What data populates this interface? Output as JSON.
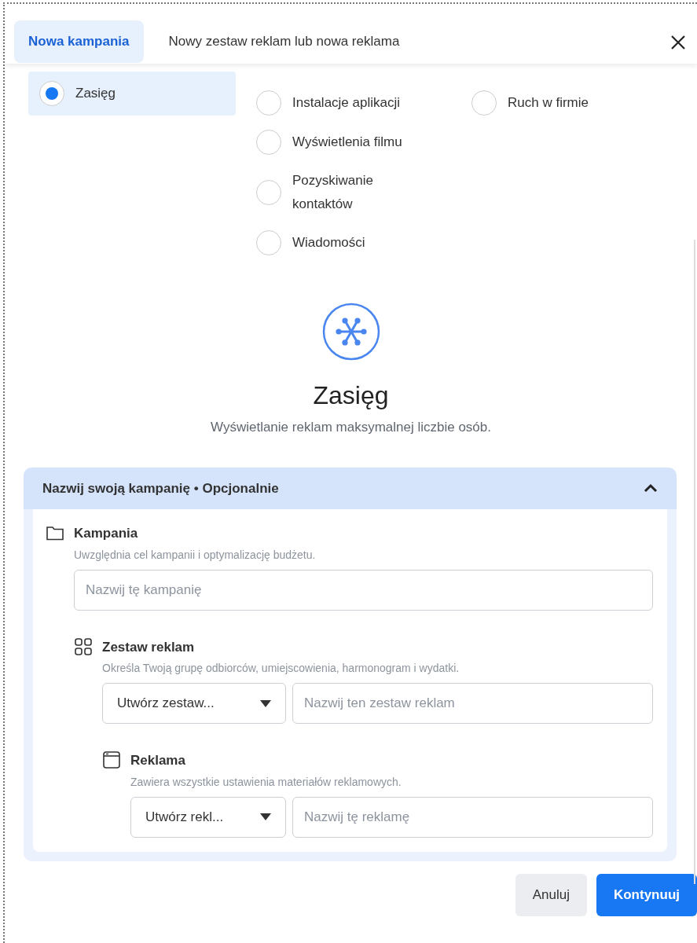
{
  "header": {
    "tabs": [
      {
        "label": "Nowa kampania",
        "selected": true
      },
      {
        "label": "Nowy zestaw reklam lub nowa reklama",
        "selected": false
      }
    ]
  },
  "sidebar": {
    "items": [
      {
        "label": "Zasięg",
        "selected": true
      }
    ]
  },
  "objectives": {
    "columns": [
      [
        {
          "label": "Instalacje aplikacji",
          "selected": false
        },
        {
          "label": "Wyświetlenia filmu",
          "selected": false
        },
        {
          "label": "Pozyskiwanie kontaktów",
          "selected": false
        },
        {
          "label": "Wiadomości",
          "selected": false
        }
      ],
      [
        {
          "label": "Ruch w firmie",
          "selected": false
        }
      ]
    ]
  },
  "summary": {
    "title": "Zasięg",
    "description": "Wyświetlanie reklam maksymalnej liczbie osób."
  },
  "naming": {
    "title": "Nazwij swoją kampanię • Opcjonalnie",
    "expanded": true,
    "levels": [
      {
        "kind": "campaign",
        "title": "Kampania",
        "description": "Uwzględnia cel kampanii i optymalizację budżetu.",
        "placeholder": "Nazwij tę kampanię"
      },
      {
        "kind": "adset",
        "title": "Zestaw reklam",
        "description": "Określa Twoją grupę odbiorców, umiejscowienia, harmonogram i wydatki.",
        "select": "Utwórz zestaw...",
        "placeholder": "Nazwij ten zestaw reklam"
      },
      {
        "kind": "ad",
        "title": "Reklama",
        "description": "Zawiera wszystkie ustawienia materiałów reklamowych.",
        "select": "Utwórz rekl...",
        "placeholder": "Nazwij tę reklamę"
      }
    ]
  },
  "footer": {
    "buttons": [
      {
        "label": "Anuluj",
        "kind": "secondary"
      },
      {
        "label": "Kontynuuj",
        "kind": "primary"
      }
    ]
  }
}
